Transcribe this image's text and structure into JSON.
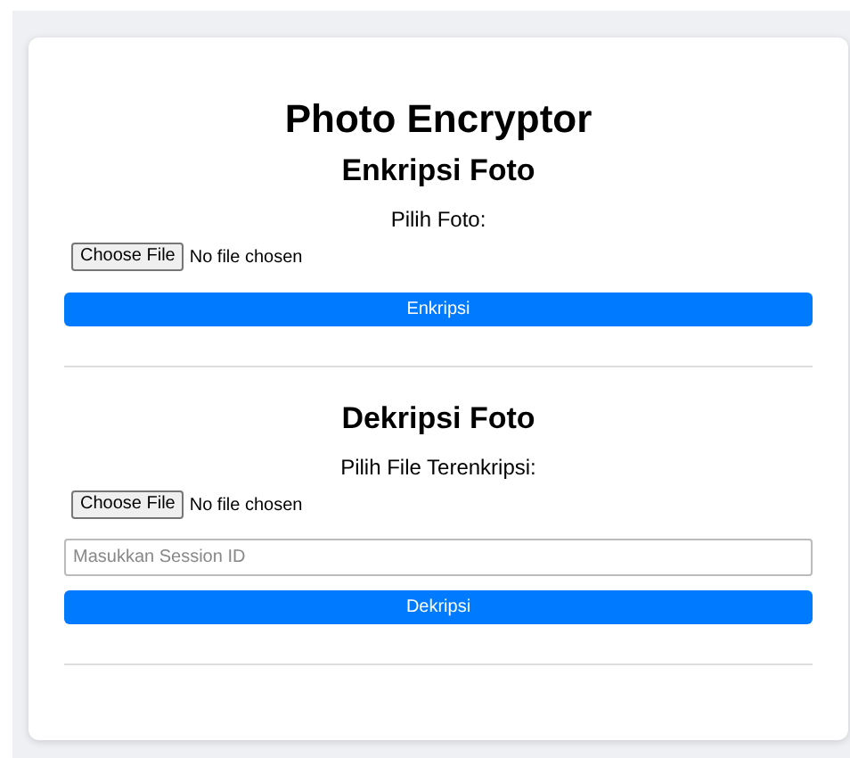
{
  "title": "Photo Encryptor",
  "sections": [
    {
      "heading": "Enkripsi Foto",
      "label": "Pilih Foto:",
      "file_button": "Choose File",
      "file_status": "No file chosen",
      "action": "Enkripsi"
    },
    {
      "heading": "Dekripsi Foto",
      "label": "Pilih File Terenkripsi:",
      "file_button": "Choose File",
      "file_status": "No file chosen",
      "session_field": {
        "placeholder": "Masukkan Session ID"
      },
      "action": "Dekripsi"
    }
  ]
}
